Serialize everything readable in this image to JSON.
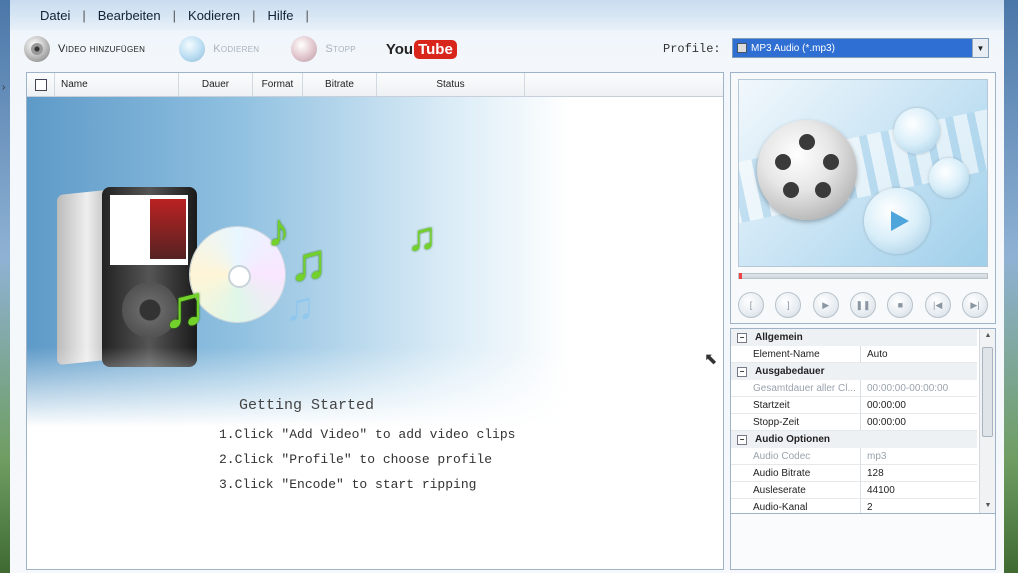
{
  "menu": {
    "items": [
      "Datei",
      "Bearbeiten",
      "Kodieren",
      "Hilfe"
    ]
  },
  "toolbar": {
    "add_video": "Video hinzufügen",
    "encode": "Kodieren",
    "stop": "Stopp",
    "youtube_you": "You",
    "youtube_tube": "Tube"
  },
  "profile": {
    "label": "Profile:",
    "selected": "MP3 Audio (*.mp3)"
  },
  "file_list": {
    "columns": [
      "Name",
      "Dauer",
      "Format",
      "Bitrate",
      "Status"
    ]
  },
  "getting_started": {
    "title": "Getting Started",
    "steps": [
      "1.Click \"Add Video\" to add video clips",
      "2.Click \"Profile\" to choose profile",
      "3.Click \"Encode\" to start ripping"
    ]
  },
  "properties": {
    "sections": [
      {
        "title": "Allgemein",
        "rows": [
          {
            "key": "Element-Name",
            "value": "Auto",
            "dim": false
          }
        ]
      },
      {
        "title": "Ausgabedauer",
        "rows": [
          {
            "key": "Gesamtdauer aller Cl...",
            "value": "00:00:00-00:00:00",
            "dim": true
          },
          {
            "key": "Startzeit",
            "value": "00:00:00",
            "dim": false
          },
          {
            "key": "Stopp-Zeit",
            "value": "00:00:00",
            "dim": false
          }
        ]
      },
      {
        "title": "Audio Optionen",
        "rows": [
          {
            "key": "Audio Codec",
            "value": "mp3",
            "dim": true
          },
          {
            "key": "Audio Bitrate",
            "value": "128",
            "dim": false
          },
          {
            "key": "Ausleserate",
            "value": "44100",
            "dim": false
          },
          {
            "key": "Audio-Kanal",
            "value": "2",
            "dim": false
          }
        ]
      }
    ]
  },
  "colors": {
    "accent": "#2f6fd4",
    "note_green": "#72d12b",
    "youtube_red": "#d9261c"
  }
}
